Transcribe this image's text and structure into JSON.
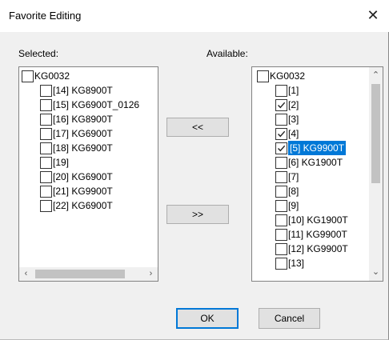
{
  "dialog": {
    "title": "Favorite Editing",
    "close_glyph": "✕"
  },
  "selected": {
    "label": "Selected:",
    "root": "KG0032",
    "items": [
      "[14] KG8900T",
      "[15] KG6900T_0126",
      "[16] KG8900T",
      "[17] KG6900T",
      "[18] KG6900T",
      "[19]",
      "[20] KG6900T",
      "[21] KG9900T",
      "[22] KG6900T"
    ]
  },
  "available": {
    "label": "Available:",
    "root": "KG0032",
    "items": [
      {
        "text": "[1]",
        "checked": false,
        "selected": false
      },
      {
        "text": "[2]",
        "checked": true,
        "selected": false
      },
      {
        "text": "[3]",
        "checked": false,
        "selected": false
      },
      {
        "text": "[4]",
        "checked": true,
        "selected": false
      },
      {
        "text": "[5] KG9900T",
        "checked": true,
        "selected": true
      },
      {
        "text": "[6] KG1900T",
        "checked": false,
        "selected": false
      },
      {
        "text": "[7]",
        "checked": false,
        "selected": false
      },
      {
        "text": "[8]",
        "checked": false,
        "selected": false
      },
      {
        "text": "[9]",
        "checked": false,
        "selected": false
      },
      {
        "text": "[10] KG1900T",
        "checked": false,
        "selected": false
      },
      {
        "text": "[11] KG9900T",
        "checked": false,
        "selected": false
      },
      {
        "text": "[12] KG9900T",
        "checked": false,
        "selected": false
      },
      {
        "text": "[13]",
        "checked": false,
        "selected": false
      }
    ]
  },
  "buttons": {
    "add": "<<",
    "remove": ">>",
    "ok": "OK",
    "cancel": "Cancel"
  },
  "colors": {
    "selection": "#0078d7",
    "default_button_border": "#0078d7"
  }
}
